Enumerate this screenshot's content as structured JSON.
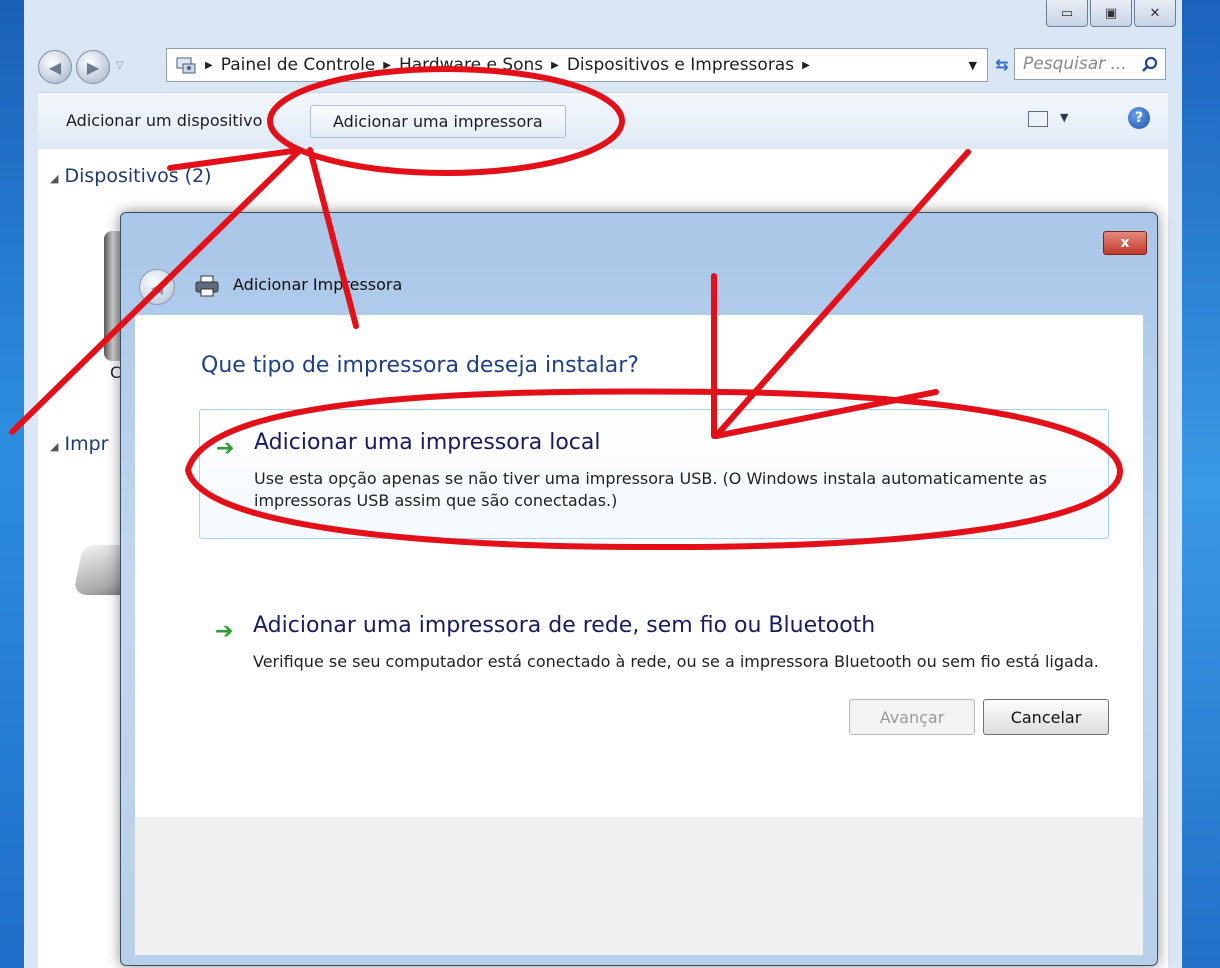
{
  "explorer": {
    "breadcrumb": [
      "Painel de Controle",
      "Hardware e Sons",
      "Dispositivos e Impressoras"
    ],
    "search_placeholder": "Pesquisar ...",
    "toolbar": {
      "add_device": "Adicionar um dispositivo",
      "add_printer": "Adicionar uma impressora"
    },
    "groups": {
      "devices": "Dispositivos (2)",
      "printers": "Impr"
    },
    "partial_label": "C"
  },
  "dialog": {
    "title": "Adicionar Impressora",
    "close": "x",
    "question": "Que tipo de impressora deseja instalar?",
    "options": [
      {
        "title": "Adicionar uma impressora local",
        "description": "Use esta opção apenas se não tiver uma impressora USB. (O Windows instala automaticamente as impressoras USB assim que são conectadas.)"
      },
      {
        "title": "Adicionar uma impressora de rede, sem fio ou Bluetooth",
        "description": "Verifique se seu computador está conectado à rede, ou se a impressora Bluetooth ou sem fio está ligada."
      }
    ],
    "buttons": {
      "next": "Avançar",
      "cancel": "Cancelar"
    }
  },
  "colors": {
    "annotation": "#e3101a",
    "link_blue": "#1e3f8a",
    "green_arrow": "#2d9b2d"
  }
}
